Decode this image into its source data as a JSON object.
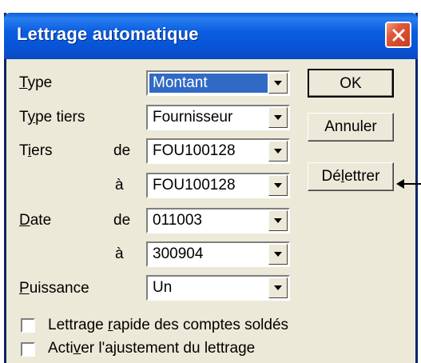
{
  "dialog": {
    "title": "Lettrage automatique",
    "close_icon": "close-icon"
  },
  "fields": {
    "type": {
      "label": "Type",
      "label_underline": "T",
      "label_rest": "ype",
      "value": "Montant"
    },
    "type_tiers": {
      "label": "Type tiers",
      "label_pre": "T",
      "label_underline": "y",
      "label_rest": "pe tiers",
      "value": "Fournisseur"
    },
    "tiers": {
      "label": "Tiers",
      "label_pre": "T",
      "label_underline": "i",
      "label_rest": "ers",
      "de_label": "de",
      "a_label": "à",
      "from": "FOU100128",
      "to": "FOU100128"
    },
    "date": {
      "label": "Date",
      "label_underline": "D",
      "label_rest": "ate",
      "de_label": "de",
      "a_label": "à",
      "from": "011003",
      "to": "300904"
    },
    "puissance": {
      "label": "Puissance",
      "label_underline": "P",
      "label_rest": "uissance",
      "value": "Un"
    }
  },
  "buttons": {
    "ok": "OK",
    "annuler": "Annuler",
    "delettrer_pre": "Dé",
    "delettrer_underline": "l",
    "delettrer_rest": "ettrer"
  },
  "checkboxes": {
    "rapide": {
      "pre": "Lettrage ",
      "underline": "r",
      "rest": "apide des comptes soldés",
      "checked": false
    },
    "ajustement": {
      "pre": "Acti",
      "underline": "v",
      "rest": "er l'ajustement du lettrage",
      "checked": false
    }
  }
}
